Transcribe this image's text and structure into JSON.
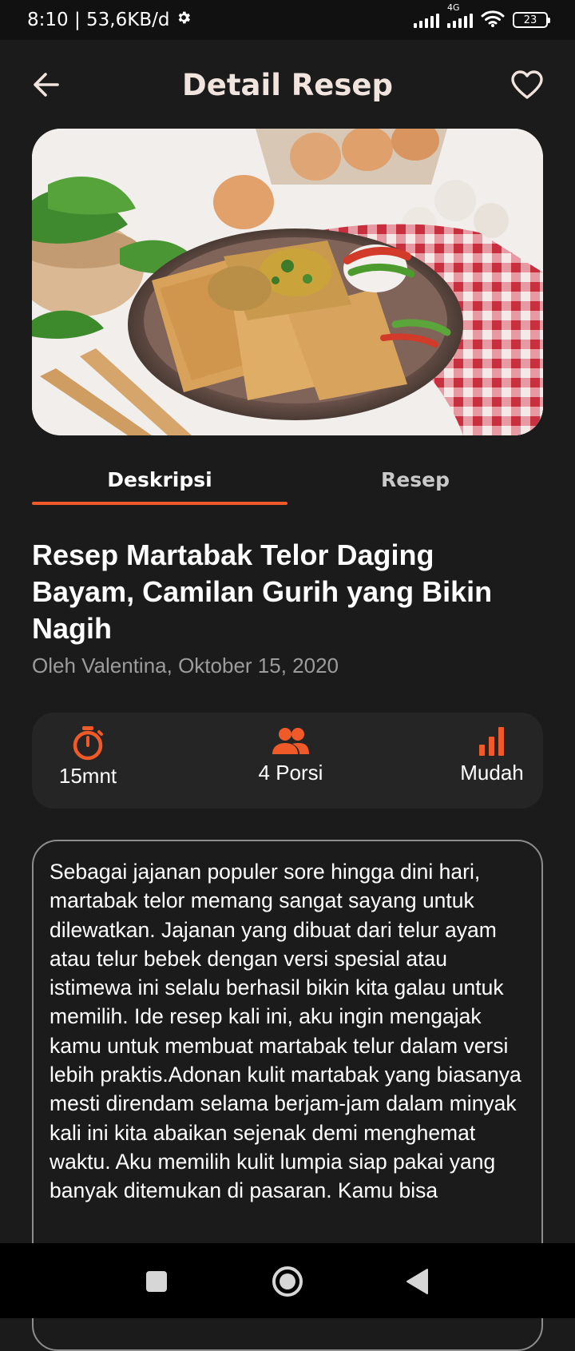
{
  "status": {
    "time_speed": "8:10 | 53,6KB/d",
    "network": "4G",
    "battery": "23"
  },
  "appbar": {
    "title": "Detail Resep"
  },
  "tabs": [
    {
      "label": "Deskripsi",
      "active": true
    },
    {
      "label": "Resep",
      "active": false
    }
  ],
  "recipe": {
    "title": "Resep Martabak Telor Daging Bayam, Camilan Gurih yang Bikin Nagih",
    "byline": "Oleh Valentina, Oktober 15, 2020",
    "stats": {
      "time": "15mnt",
      "portion": "4 Porsi",
      "difficulty": "Mudah"
    },
    "description": "Sebagai jajanan populer sore hingga dini hari, martabak telor memang sangat sayang untuk dilewatkan. Jajanan yang dibuat dari telur ayam atau telur bebek dengan versi spesial atau istimewa ini selalu berhasil bikin kita galau untuk memilih. Ide resep kali ini, aku ingin mengajak kamu untuk membuat martabak telur dalam versi lebih praktis.Adonan kulit martabak yang biasanya mesti direndam selama berjam-jam dalam minyak kali ini kita abaikan sejenak demi menghemat waktu. Aku memilih kulit lumpia siap pakai yang banyak ditemukan di pasaran. Kamu bisa"
  },
  "colors": {
    "accent": "#f05a28",
    "background": "#1b1b1c",
    "card": "#252526",
    "title": "#f1e4de"
  },
  "icons": [
    "settings-icon",
    "signal-icon",
    "wifi-icon",
    "battery-icon",
    "back-arrow-icon",
    "heart-icon",
    "timer-icon",
    "people-icon",
    "bar-chart-icon",
    "recent-apps-icon",
    "home-icon",
    "back-nav-icon"
  ]
}
